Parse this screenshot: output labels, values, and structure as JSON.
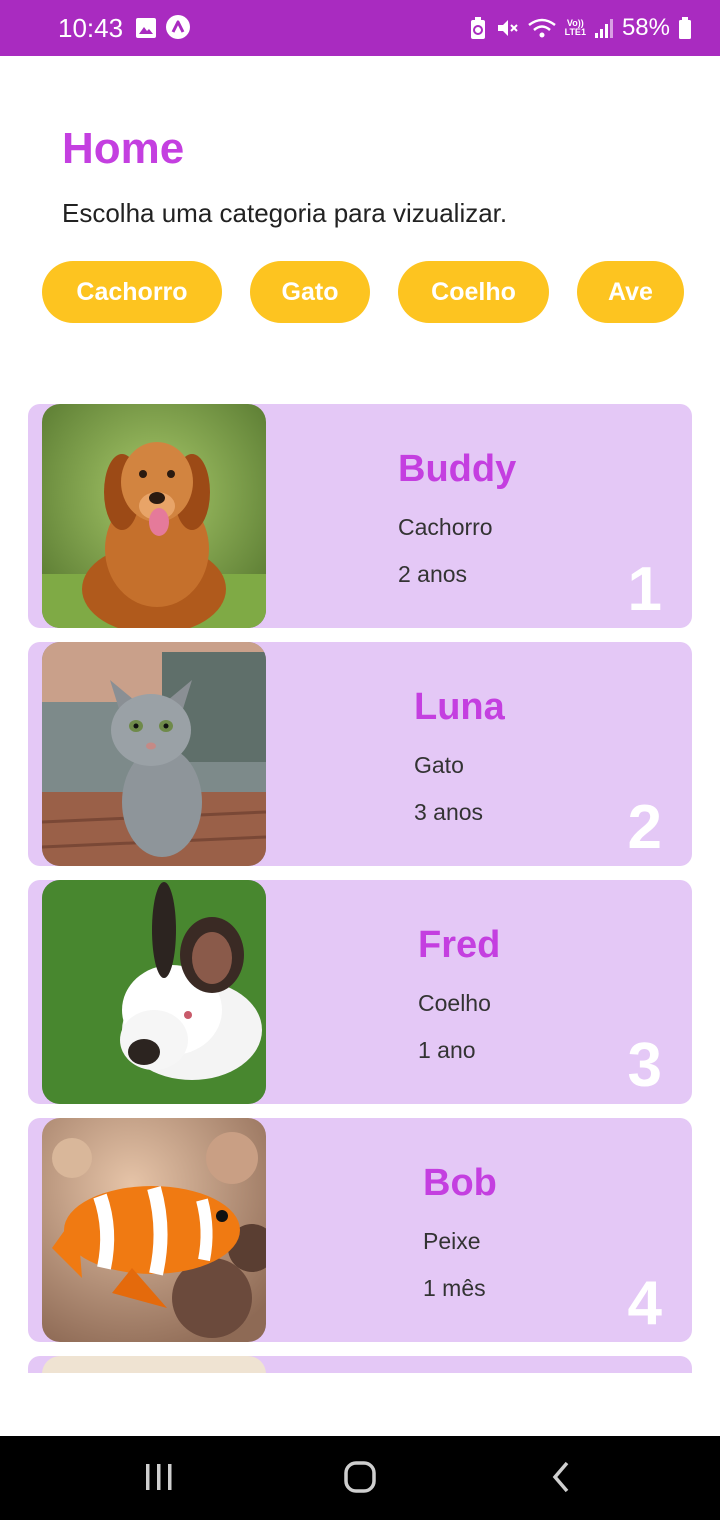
{
  "status_bar": {
    "time": "10:43",
    "battery": "58%",
    "network_label_top": "Vo))",
    "network_label_bottom": "LTE1",
    "icons": [
      "image-icon",
      "app-a-icon",
      "battery-saver-icon",
      "mute-icon",
      "wifi-icon",
      "volte-icon",
      "signal-icon",
      "battery-icon"
    ]
  },
  "header": {
    "title": "Home",
    "subtitle": "Escolha uma categoria para vizualizar."
  },
  "categories": [
    {
      "label": "Cachorro"
    },
    {
      "label": "Gato"
    },
    {
      "label": "Coelho"
    },
    {
      "label": "Ave"
    }
  ],
  "pets": [
    {
      "name": "Buddy",
      "species": "Cachorro",
      "age": "2 anos",
      "rank": "1",
      "image": "golden-retriever-photo"
    },
    {
      "name": "Luna",
      "species": "Gato",
      "age": "3 anos",
      "rank": "2",
      "image": "gray-cat-photo"
    },
    {
      "name": "Fred",
      "species": "Coelho",
      "age": "1 ano",
      "rank": "3",
      "image": "white-rabbit-photo"
    },
    {
      "name": "Bob",
      "species": "Peixe",
      "age": "1 mês",
      "rank": "4",
      "image": "clownfish-photo"
    }
  ],
  "colors": {
    "status_bar": "#a92bc0",
    "accent_purple": "#c43fe0",
    "chip_yellow": "#fdc420",
    "card_bg": "#e4c8f6"
  },
  "nav_bar": {
    "buttons": [
      "recents-icon",
      "home-icon",
      "back-icon"
    ]
  }
}
